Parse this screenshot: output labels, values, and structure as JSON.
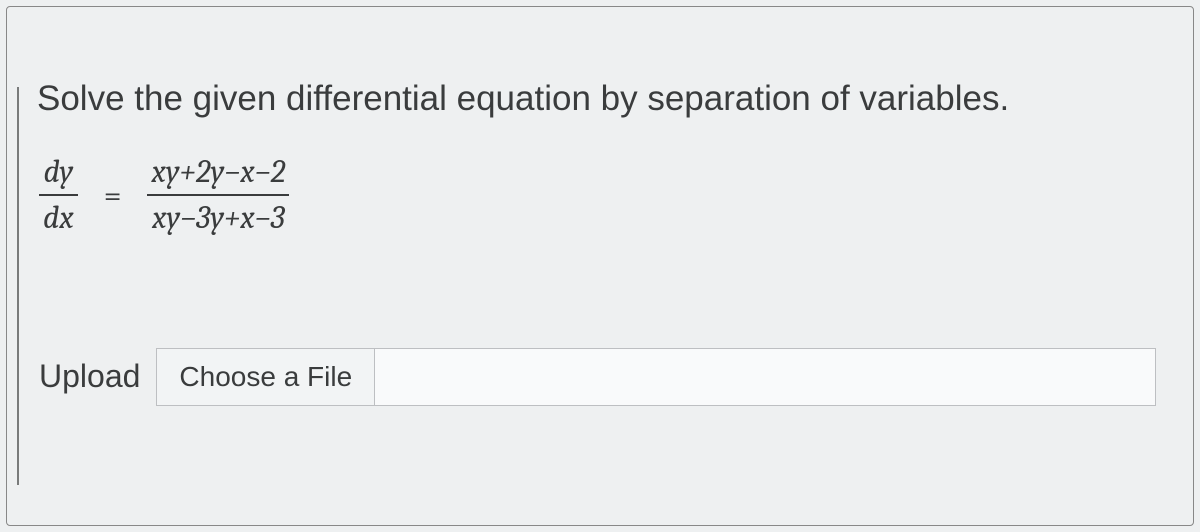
{
  "title": "Solve the given differential equation by separation of variables.",
  "equation": {
    "left_top": "dy",
    "left_bot": "dx",
    "right_top": "xy+2y−x−2",
    "right_bot": "xy−3y+x−3",
    "equals": "="
  },
  "upload": {
    "label": "Upload",
    "button": "Choose a File"
  }
}
